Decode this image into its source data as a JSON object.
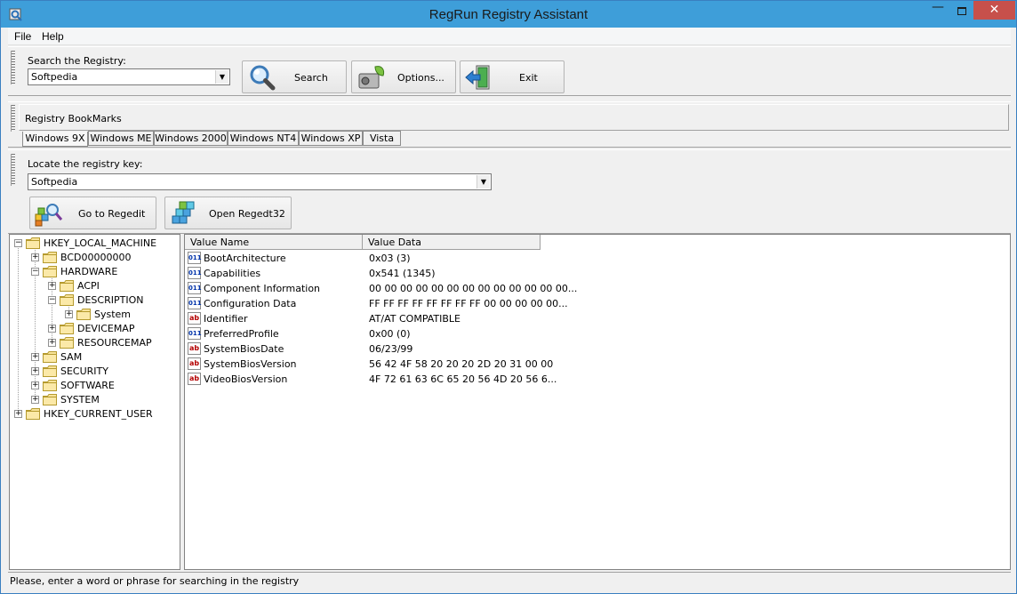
{
  "window": {
    "title": "RegRun Registry Assistant",
    "minimize": "—",
    "close": "✕"
  },
  "menu": {
    "file": "File",
    "help": "Help"
  },
  "search": {
    "label": "Search the Registry:",
    "value": "Softpedia",
    "search_button": "Search",
    "options_button": "Options...",
    "exit_button": "Exit"
  },
  "bookmarks": {
    "title": "Registry BookMarks",
    "tabs": [
      "Windows 9X",
      "Windows ME",
      "Windows 2000",
      "Windows NT4",
      "Windows XP",
      "Vista"
    ],
    "active_tab": 0
  },
  "locate": {
    "label": "Locate the registry key:",
    "value": "Softpedia",
    "goto_button": "Go to Regedit",
    "open_button": "Open Regedt32"
  },
  "tree": [
    {
      "label": "HKEY_LOCAL_MACHINE",
      "level": 0,
      "expander": "−"
    },
    {
      "label": "BCD00000000",
      "level": 1,
      "expander": "+"
    },
    {
      "label": "HARDWARE",
      "level": 1,
      "expander": "−"
    },
    {
      "label": "ACPI",
      "level": 2,
      "expander": "+"
    },
    {
      "label": "DESCRIPTION",
      "level": 2,
      "expander": "−"
    },
    {
      "label": "System",
      "level": 3,
      "expander": "+"
    },
    {
      "label": "DEVICEMAP",
      "level": 2,
      "expander": "+"
    },
    {
      "label": "RESOURCEMAP",
      "level": 2,
      "expander": "+"
    },
    {
      "label": "SAM",
      "level": 1,
      "expander": "+"
    },
    {
      "label": "SECURITY",
      "level": 1,
      "expander": "+"
    },
    {
      "label": "SOFTWARE",
      "level": 1,
      "expander": "+"
    },
    {
      "label": "SYSTEM",
      "level": 1,
      "expander": "+"
    },
    {
      "label": "HKEY_CURRENT_USER",
      "level": 0,
      "expander": "+"
    }
  ],
  "list": {
    "columns": [
      "Value Name",
      "Value Data"
    ],
    "rows": [
      {
        "icon": "binary-value-icon",
        "icon_text": "011\n110",
        "name": "BootArchitecture",
        "data": "0x03 (3)"
      },
      {
        "icon": "binary-value-icon",
        "icon_text": "011\n110",
        "name": "Capabilities",
        "data": "0x541 (1345)"
      },
      {
        "icon": "binary-value-icon",
        "icon_text": "011\n110",
        "name": "Component Information",
        "data": "00 00 00 00 00 00 00 00 00 00 00 00 00..."
      },
      {
        "icon": "binary-value-icon",
        "icon_text": "011\n110",
        "name": "Configuration Data",
        "data": "FF FF FF FF FF FF FF FF 00 00 00 00 00..."
      },
      {
        "icon": "string-value-icon",
        "icon_text": "ab",
        "name": "Identifier",
        "data": "AT/AT COMPATIBLE"
      },
      {
        "icon": "binary-value-icon",
        "icon_text": "011\n110",
        "name": "PreferredProfile",
        "data": "0x00 (0)"
      },
      {
        "icon": "string-value-icon",
        "icon_text": "ab",
        "name": "SystemBiosDate",
        "data": "06/23/99"
      },
      {
        "icon": "string-value-icon",
        "icon_text": "ab",
        "name": "SystemBiosVersion",
        "data": "56 42 4F 58 20 20 20 2D 20 31 00 00"
      },
      {
        "icon": "string-value-icon",
        "icon_text": "ab",
        "name": "VideoBiosVersion",
        "data": "4F 72 61 63 6C 65 20 56 4D 20 56 6..."
      }
    ]
  },
  "status": "Please, enter a word or phrase for searching in the registry",
  "colors": {
    "titlebar": "#3e9ed9",
    "close": "#c7504b"
  }
}
